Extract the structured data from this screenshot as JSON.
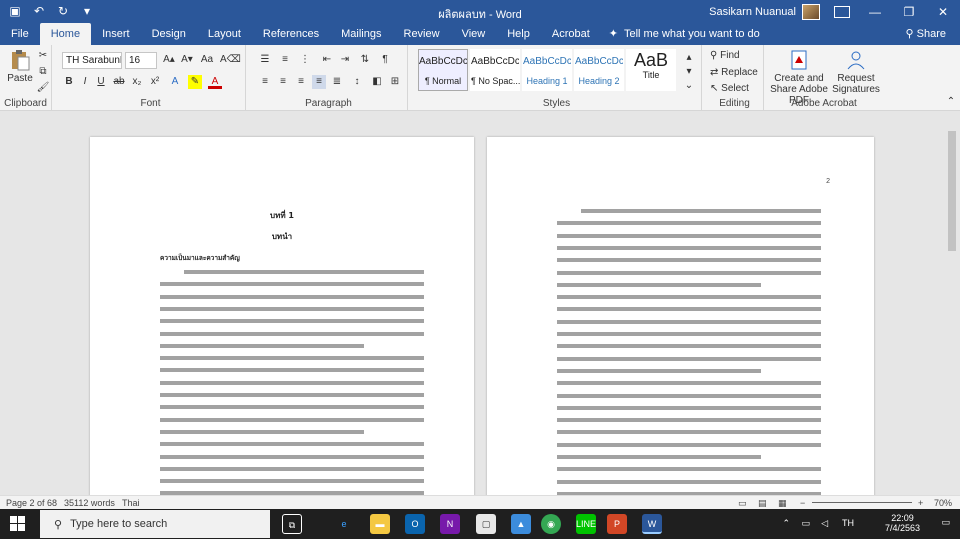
{
  "window": {
    "title": "ผลิตผลบท - Word",
    "user": "Sasikarn Nuanual",
    "share": "Share"
  },
  "tabs": [
    "File",
    "Home",
    "Insert",
    "Design",
    "Layout",
    "References",
    "Mailings",
    "Review",
    "View",
    "Help",
    "Acrobat"
  ],
  "tell_me": "Tell me what you want to do",
  "ribbon": {
    "clipboard": {
      "label": "Clipboard",
      "paste": "Paste"
    },
    "font": {
      "label": "Font",
      "family": "TH SarabunP",
      "size": "16"
    },
    "paragraph": {
      "label": "Paragraph"
    },
    "styles": {
      "label": "Styles",
      "items": [
        {
          "preview": "AaBbCcDc",
          "name": "¶ Normal"
        },
        {
          "preview": "AaBbCcDc",
          "name": "¶ No Spac..."
        },
        {
          "preview": "AaBbCcDc",
          "name": "Heading 1"
        },
        {
          "preview": "AaBbCcDc",
          "name": "Heading 2"
        },
        {
          "preview": "AaB",
          "name": "Title"
        }
      ]
    },
    "editing": {
      "label": "Editing",
      "find": "Find",
      "replace": "Replace",
      "select": "Select"
    },
    "adobe": {
      "label": "Adobe Acrobat",
      "create": "Create and Share Adobe PDF",
      "request": "Request Signatures"
    }
  },
  "page1": {
    "chapter": "บทที่ 1",
    "chapter_title": "บทนำ",
    "section": "ความเป็นมาและความสำคัญ"
  },
  "page2": {
    "number": "2"
  },
  "status": {
    "page": "Page 2 of 68",
    "words": "35112 words",
    "lang": "Thai",
    "zoom": "70%"
  },
  "taskbar": {
    "search": "Type here to search",
    "lang": "TH",
    "time": "22:09",
    "date": "7/4/2563"
  },
  "colors": {
    "word_blue": "#2b579a",
    "ribbon_bg": "#f3f3f3",
    "taskbar": "#1f1f1f"
  }
}
